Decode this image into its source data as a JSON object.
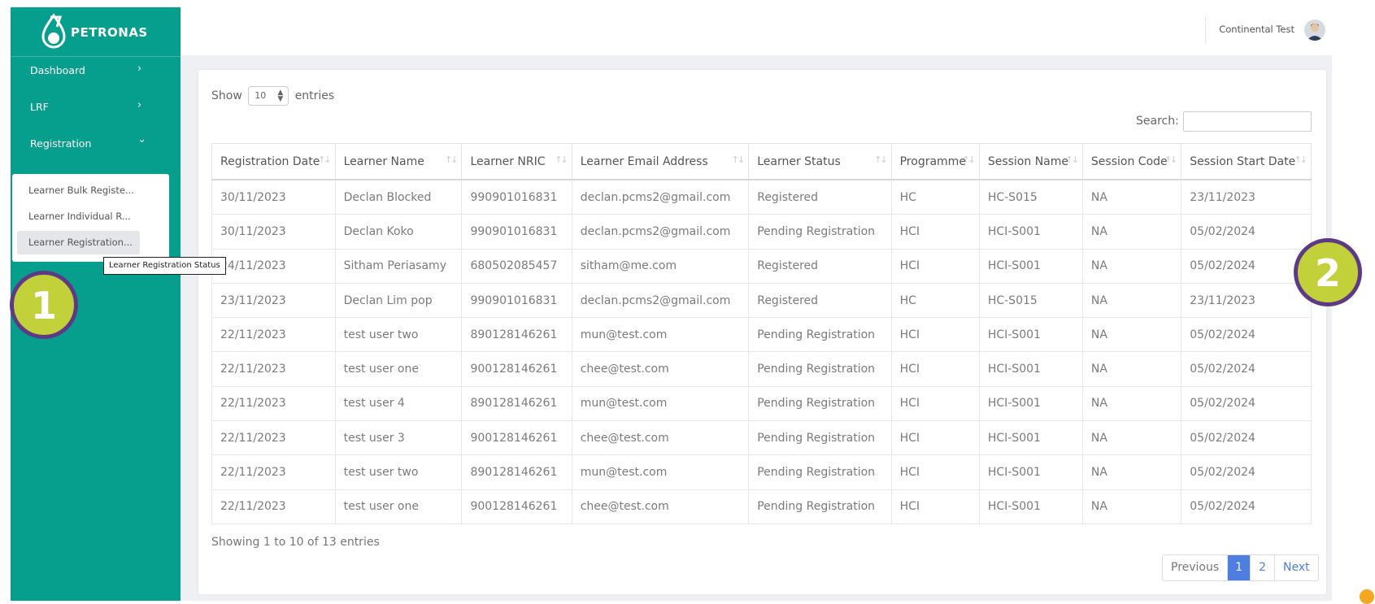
{
  "brand": {
    "name": "PETRONAS",
    "color": "#069e8d"
  },
  "sidebar": {
    "items": [
      {
        "label": "Dashboard",
        "chevron": "›"
      },
      {
        "label": "LRF",
        "chevron": "›"
      },
      {
        "label": "Registration",
        "chevron": "⌄"
      }
    ],
    "submenu": [
      {
        "label": "Learner Bulk Registe..."
      },
      {
        "label": "Learner Individual R..."
      },
      {
        "label": "Learner Registration..."
      }
    ],
    "tooltip": "Learner Registration Status"
  },
  "badges": {
    "one": "1",
    "two": "2",
    "fill_color": "#c2d03a",
    "ring_color": "#5e3a86"
  },
  "header": {
    "user_name": "Continental Test"
  },
  "table_controls": {
    "show_label": "Show",
    "entries_value": "10",
    "entries_label": "entries",
    "search_label": "Search:"
  },
  "table": {
    "columns": [
      "Registration Date",
      "Learner Name",
      "Learner NRIC",
      "Learner Email Address",
      "Learner Status",
      "Programme",
      "Session Name",
      "Session Code",
      "Session Start Date"
    ],
    "rows": [
      [
        "30/11/2023",
        "Declan Blocked",
        "990901016831",
        "declan.pcms2@gmail.com",
        "Registered",
        "HC",
        "HC-S015",
        "NA",
        "23/11/2023"
      ],
      [
        "30/11/2023",
        "Declan Koko",
        "990901016831",
        "declan.pcms2@gmail.com",
        "Pending Registration",
        "HCI",
        "HCI-S001",
        "NA",
        "05/02/2024"
      ],
      [
        "24/11/2023",
        "Sitham Periasamy",
        "680502085457",
        "sitham@me.com",
        "Registered",
        "HCI",
        "HCI-S001",
        "NA",
        "05/02/2024"
      ],
      [
        "23/11/2023",
        "Declan Lim pop",
        "990901016831",
        "declan.pcms2@gmail.com",
        "Registered",
        "HC",
        "HC-S015",
        "NA",
        "23/11/2023"
      ],
      [
        "22/11/2023",
        "test user two",
        "890128146261",
        "mun@test.com",
        "Pending Registration",
        "HCI",
        "HCI-S001",
        "NA",
        "05/02/2024"
      ],
      [
        "22/11/2023",
        "test user one",
        "900128146261",
        "chee@test.com",
        "Pending Registration",
        "HCI",
        "HCI-S001",
        "NA",
        "05/02/2024"
      ],
      [
        "22/11/2023",
        "test user 4",
        "890128146261",
        "mun@test.com",
        "Pending Registration",
        "HCI",
        "HCI-S001",
        "NA",
        "05/02/2024"
      ],
      [
        "22/11/2023",
        "test user 3",
        "900128146261",
        "chee@test.com",
        "Pending Registration",
        "HCI",
        "HCI-S001",
        "NA",
        "05/02/2024"
      ],
      [
        "22/11/2023",
        "test user two",
        "890128146261",
        "mun@test.com",
        "Pending Registration",
        "HCI",
        "HCI-S001",
        "NA",
        "05/02/2024"
      ],
      [
        "22/11/2023",
        "test user one",
        "900128146261",
        "chee@test.com",
        "Pending Registration",
        "HCI",
        "HCI-S001",
        "NA",
        "05/02/2024"
      ]
    ]
  },
  "footer": {
    "info": "Showing 1 to 10 of 13 entries",
    "pagination": {
      "previous": "Previous",
      "pages": [
        "1",
        "2"
      ],
      "current": "1",
      "next": "Next"
    }
  }
}
